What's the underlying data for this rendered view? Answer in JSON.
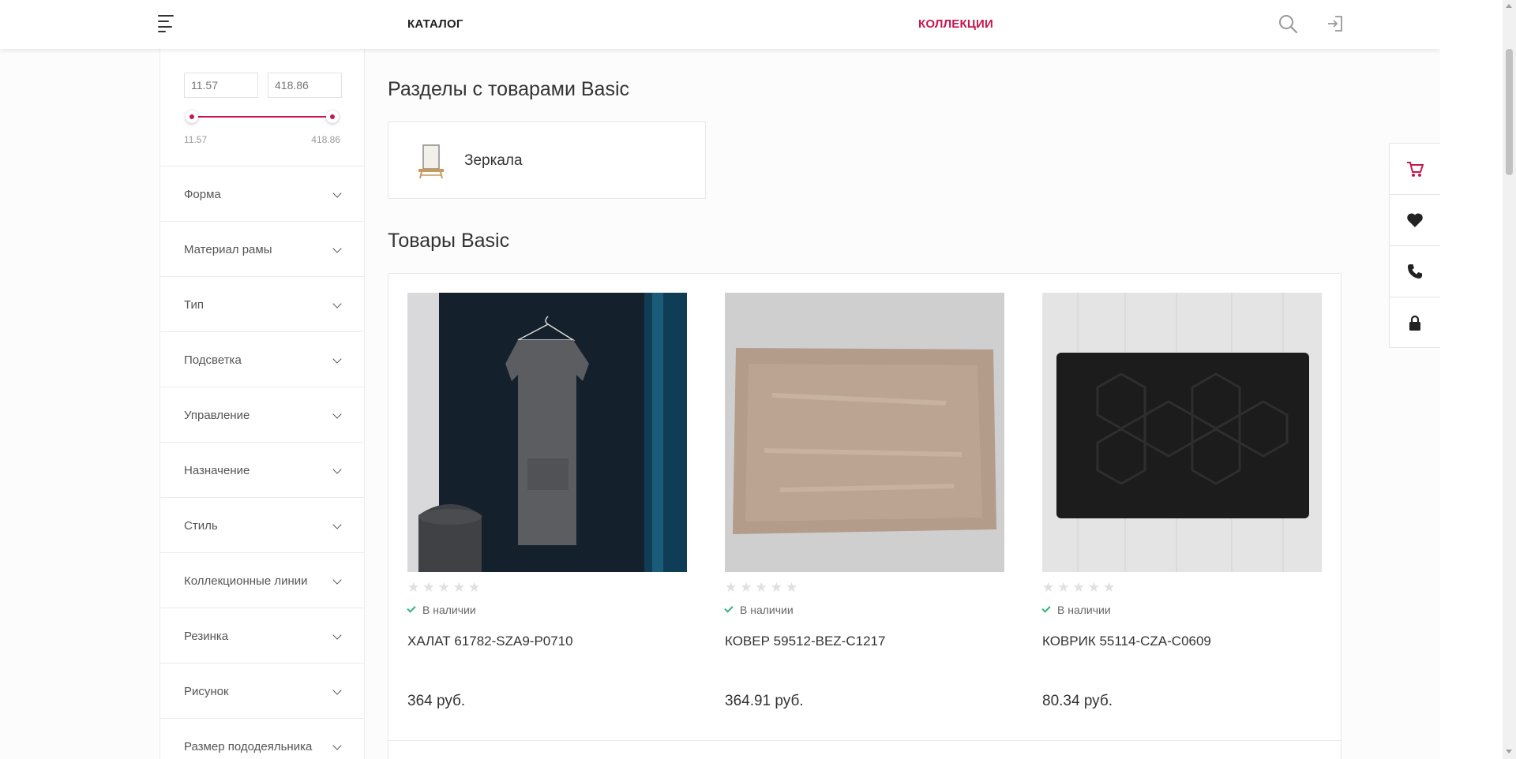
{
  "header": {
    "catalog_label": "КАТАЛОГ",
    "collections_label": "КОЛЛЕКЦИИ",
    "accent_color": "#c8164f",
    "icons": [
      "menu-icon",
      "search-icon",
      "login-icon"
    ]
  },
  "sidebar": {
    "price": {
      "min_value": "11.57",
      "max_value": "418.86",
      "min_label": "11.57",
      "max_label": "418.86"
    },
    "filters": [
      {
        "label": "Форма"
      },
      {
        "label": "Материал рамы"
      },
      {
        "label": "Тип"
      },
      {
        "label": "Подсветка"
      },
      {
        "label": "Управление"
      },
      {
        "label": "Назначение"
      },
      {
        "label": "Стиль"
      },
      {
        "label": "Коллекционные линии"
      },
      {
        "label": "Резинка"
      },
      {
        "label": "Рисунок"
      },
      {
        "label": "Размер пододеяльника"
      }
    ]
  },
  "main": {
    "sections_title": "Разделы с товарами Basic",
    "section_card": {
      "name": "Зеркала"
    },
    "products_title": "Товары Basic",
    "products": [
      {
        "name": "ХАЛАТ 61782-SZA9-P0710",
        "price": "364 руб.",
        "stock": "В наличии",
        "rating": 0
      },
      {
        "name": "КОВЕР 59512-BEZ-C1217",
        "price": "364.91 руб.",
        "stock": "В наличии",
        "rating": 0
      },
      {
        "name": "КОВРИК 55114-CZA-C0609",
        "price": "80.34 руб.",
        "stock": "В наличии",
        "rating": 0
      }
    ]
  },
  "float_panel": {
    "icons": [
      "cart-icon",
      "heart-icon",
      "phone-icon",
      "lock-icon"
    ]
  }
}
